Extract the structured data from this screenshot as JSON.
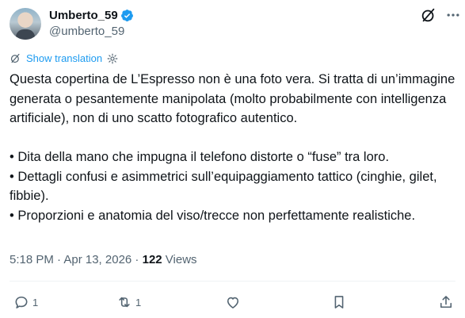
{
  "author": {
    "name": "Umberto_59",
    "handle": "@umberto_59"
  },
  "translation": {
    "label": "Show translation"
  },
  "tweet": {
    "paragraph": "Questa copertina de L’Espresso non è una foto vera. Si tratta di un’immagine generata o pesantemente manipolata (molto probabilmente con intelligenza artificiale), non di uno scatto fotografico autentico.",
    "bullets": [
      "•  Dita della mano che impugna il telefono distorte o “fuse” tra loro.",
      "•  Dettagli confusi e asimmetrici sull’equipaggiamento tattico (cinghie, gilet, fibbie).",
      "•  Proporzioni e anatomia del viso/trecce non perfettamente realistiche."
    ]
  },
  "meta": {
    "timestamp": "5:18 PM · Apr 13, 2026",
    "separator": " · ",
    "views_count": "122",
    "views_label": " Views"
  },
  "actions": {
    "replies": "1",
    "reposts": "1"
  },
  "colors": {
    "verified": "#1d9bf0",
    "link": "#1d9bf0",
    "muted": "#536471"
  }
}
